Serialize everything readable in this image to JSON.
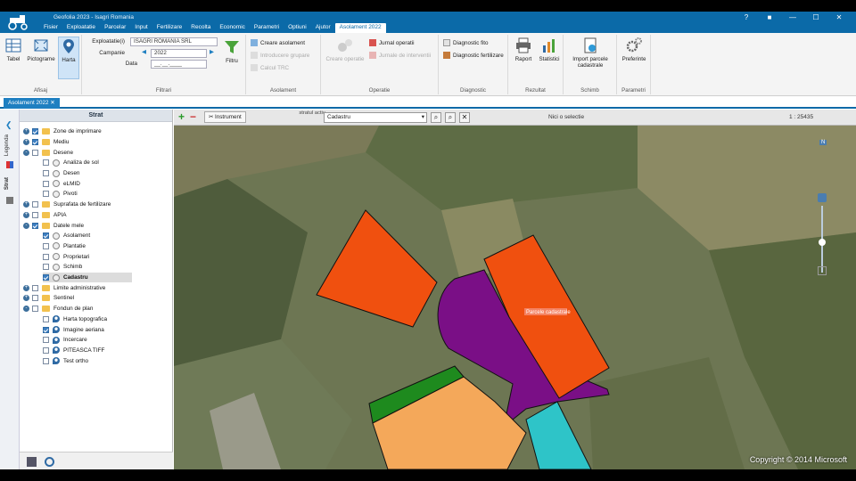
{
  "app": {
    "title": "Geofolia 2023 - Isagri Romania",
    "menus": [
      "Fisier",
      "Exploatatie",
      "Parcelar",
      "Input",
      "Fertilizare",
      "Recolta",
      "Economic",
      "Parametri",
      "Optiuni",
      "Ajutor",
      "Asolament 2022"
    ],
    "active_menu": "Asolament 2022",
    "window_controls": [
      "?",
      "■",
      "—",
      "☐",
      "✕"
    ]
  },
  "ribbon": {
    "afisaj": {
      "label": "Afisaj",
      "buttons": [
        "Tabel",
        "Pictograme",
        "Harta"
      ]
    },
    "filtrari": {
      "label": "Filtrari",
      "exploatatie_label": "Exploatatie(i)",
      "exploatatie_value": "ISAGRI ROMANIA SRL",
      "campanie_label": "Campanie",
      "campanie_value": "2022",
      "data_label": "Data",
      "data_value": "__.__.____",
      "filter_button": "Filtru"
    },
    "asolament": {
      "label": "Asolament",
      "items": [
        "Creare asolament",
        "Introducere grupare",
        "Calcul TRC"
      ]
    },
    "operatie": {
      "label": "Operatie",
      "big": "Creare operatie",
      "items": [
        "Jurnal operatii",
        "Jurnale de interventii"
      ]
    },
    "diagnostic": {
      "label": "Diagnostic",
      "items": [
        "Diagnostic fito",
        "Diagnostic fertilizare"
      ]
    },
    "rezultat": {
      "label": "Rezultat",
      "buttons": [
        "Raport",
        "Statistici"
      ]
    },
    "schimb": {
      "label": "Schimb",
      "buttons": [
        "Import parcele cadastrale"
      ]
    },
    "parametri": {
      "label": "Parametri",
      "buttons": [
        "Preferinte"
      ]
    }
  },
  "doc_tab": "Asolament 2022",
  "side_tabs": [
    "Legenda",
    "Strat"
  ],
  "panel": {
    "title": "Strat",
    "tree": [
      {
        "label": "Zone de imprimare",
        "level": 0,
        "exp": "+",
        "checked": true,
        "icon": "folder"
      },
      {
        "label": "Mediu",
        "level": 0,
        "exp": "+",
        "checked": true,
        "icon": "folder"
      },
      {
        "label": "Desene",
        "level": 0,
        "exp": "-",
        "checked": false,
        "icon": "folder"
      },
      {
        "label": "Analiza de sol",
        "level": 1,
        "checked": false,
        "icon": "layer"
      },
      {
        "label": "Desen",
        "level": 1,
        "checked": false,
        "icon": "layer"
      },
      {
        "label": "eLMID",
        "level": 1,
        "checked": false,
        "icon": "layer"
      },
      {
        "label": "Pivoti",
        "level": 1,
        "checked": false,
        "icon": "layer"
      },
      {
        "label": "Suprafata de fertilizare",
        "level": 0,
        "exp": "+",
        "checked": false,
        "icon": "folder"
      },
      {
        "label": "APIA",
        "level": 0,
        "exp": "+",
        "checked": false,
        "icon": "folder"
      },
      {
        "label": "Datele mele",
        "level": 0,
        "exp": "-",
        "checked": true,
        "icon": "folder"
      },
      {
        "label": "Asolament",
        "level": 1,
        "checked": true,
        "icon": "layer"
      },
      {
        "label": "Plantatie",
        "level": 1,
        "checked": false,
        "icon": "layer"
      },
      {
        "label": "Proprietari",
        "level": 1,
        "checked": false,
        "icon": "layer"
      },
      {
        "label": "Schimb",
        "level": 1,
        "checked": false,
        "icon": "layer"
      },
      {
        "label": "Cadastru",
        "level": 1,
        "checked": true,
        "icon": "layer",
        "selected": true
      },
      {
        "label": "Limite administrative",
        "level": 0,
        "exp": "+",
        "checked": false,
        "icon": "folder"
      },
      {
        "label": "Sentinel",
        "level": 0,
        "exp": "+",
        "checked": false,
        "icon": "folder"
      },
      {
        "label": "Fondun de plan",
        "level": 0,
        "exp": "-",
        "checked": false,
        "icon": "folder"
      },
      {
        "label": "Harta topografica",
        "level": 1,
        "checked": false,
        "icon": "pin"
      },
      {
        "label": "Imagine aeriana",
        "level": 1,
        "checked": true,
        "icon": "pin"
      },
      {
        "label": "Incercare",
        "level": 1,
        "checked": false,
        "icon": "pin"
      },
      {
        "label": "PITEASCA TIFF",
        "level": 1,
        "checked": false,
        "icon": "pin"
      },
      {
        "label": "Test ortho",
        "level": 1,
        "checked": false,
        "icon": "pin"
      }
    ]
  },
  "map_toolbar": {
    "instrument": "Instrument",
    "strat_label": "stratul activ",
    "strat_value": "Cadastru",
    "selection": "Nici o selectie",
    "scale": "1 : 25435"
  },
  "map": {
    "feature_label": "Parcele cadastrale",
    "copyright": "Copyright © 2014 Microsoft",
    "compass": "N",
    "colors": {
      "orange": "#f0500f",
      "purple": "#7a0f86",
      "peach": "#f4a85a",
      "green": "#1e8a1e",
      "cyan": "#2ec4c8"
    }
  }
}
